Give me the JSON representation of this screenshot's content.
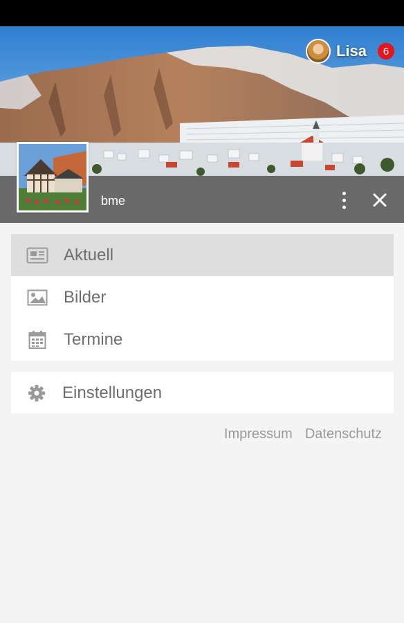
{
  "header": {
    "user_name": "Lisa",
    "notification_count": "6",
    "group_name": "bme"
  },
  "menu": {
    "main_items": [
      {
        "label": "Aktuell",
        "icon": "newspaper-icon",
        "active": true
      },
      {
        "label": "Bilder",
        "icon": "image-icon",
        "active": false
      },
      {
        "label": "Termine",
        "icon": "calendar-icon",
        "active": false
      }
    ],
    "settings_item": {
      "label": "Einstellungen",
      "icon": "gear-icon"
    }
  },
  "footer": {
    "impressum": "Impressum",
    "datenschutz": "Datenschutz"
  },
  "colors": {
    "header_bar": "#6a6a6a",
    "badge": "#e8141c",
    "active_item": "#dedede",
    "page_background": "#f4f4f4"
  }
}
